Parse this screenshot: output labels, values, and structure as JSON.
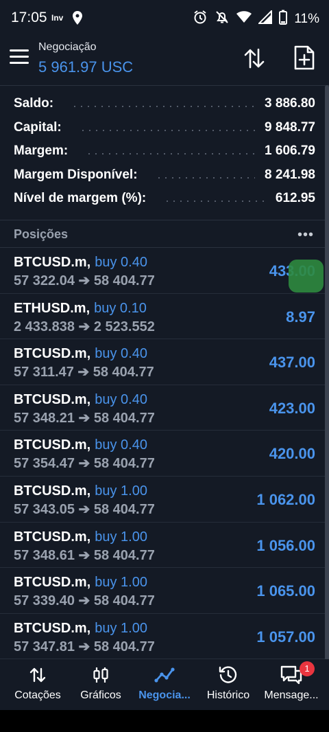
{
  "status_bar": {
    "time": "17:05",
    "carrier_icon_text": "Inv",
    "battery": "11%"
  },
  "header": {
    "account_name": "Negociação",
    "balance": "5 961.97 USC"
  },
  "summary": [
    {
      "label": "Saldo:",
      "value": "3 886.80"
    },
    {
      "label": "Capital:",
      "value": "9 848.77"
    },
    {
      "label": "Margem:",
      "value": "1 606.79"
    },
    {
      "label": "Margem Disponível:",
      "value": "8 241.98"
    },
    {
      "label": "Nível de margem (%):",
      "value": "612.95"
    }
  ],
  "positions_title": "Posições",
  "positions_more": "•••",
  "positions": [
    {
      "symbol": "BTCUSD.m,",
      "side": "buy 0.40",
      "prices": "57 322.04 ➔ 58 404.77",
      "profit": "433.00"
    },
    {
      "symbol": "ETHUSD.m,",
      "side": "buy 0.10",
      "prices": "2 433.838 ➔ 2 523.552",
      "profit": "8.97"
    },
    {
      "symbol": "BTCUSD.m,",
      "side": "buy 0.40",
      "prices": "57 311.47 ➔ 58 404.77",
      "profit": "437.00"
    },
    {
      "symbol": "BTCUSD.m,",
      "side": "buy 0.40",
      "prices": "57 348.21 ➔ 58 404.77",
      "profit": "423.00"
    },
    {
      "symbol": "BTCUSD.m,",
      "side": "buy 0.40",
      "prices": "57 354.47 ➔ 58 404.77",
      "profit": "420.00"
    },
    {
      "symbol": "BTCUSD.m,",
      "side": "buy 1.00",
      "prices": "57 343.05 ➔ 58 404.77",
      "profit": "1 062.00"
    },
    {
      "symbol": "BTCUSD.m,",
      "side": "buy 1.00",
      "prices": "57 348.61 ➔ 58 404.77",
      "profit": "1 056.00"
    },
    {
      "symbol": "BTCUSD.m,",
      "side": "buy 1.00",
      "prices": "57 339.40 ➔ 58 404.77",
      "profit": "1 065.00"
    },
    {
      "symbol": "BTCUSD.m,",
      "side": "buy 1.00",
      "prices": "57 347.81 ➔ 58 404.77",
      "profit": "1 057.00"
    }
  ],
  "nav": [
    {
      "label": "Cotações",
      "icon": "quotes-icon"
    },
    {
      "label": "Gráficos",
      "icon": "charts-icon"
    },
    {
      "label": "Negocia...",
      "icon": "trade-icon",
      "active": true
    },
    {
      "label": "Histórico",
      "icon": "history-icon"
    },
    {
      "label": "Mensage...",
      "icon": "messages-icon",
      "badge": "1"
    }
  ],
  "colors": {
    "background": "#141a25",
    "accent": "#4a94ec",
    "muted_text": "#9aa2af",
    "badge": "#e9353f"
  }
}
